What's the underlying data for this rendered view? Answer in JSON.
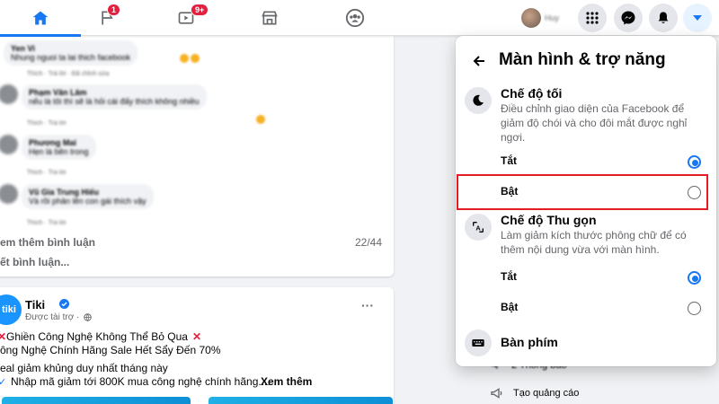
{
  "nav": {
    "flag_badge": "1",
    "watch_badge": "9+",
    "profile_name": "Huy"
  },
  "feed": {
    "comments": [
      {
        "name": "Yen Vi",
        "text": "Nhung nguoi ta lai thich facebook",
        "actions": "Thích · Trả lời · Đã chỉnh sửa"
      },
      {
        "name": "Phạm Văn Lâm",
        "text": "nếu là tôi thì sẽ là hỏi cái đấy thích không nhiều",
        "actions": "Thích · Trả lời"
      },
      {
        "name": "Phương Mai",
        "text": "Hẹn là bên trong",
        "actions": "Thích · Trả lời"
      },
      {
        "name": "Vũ Gia Trung Hiếu",
        "text": "Và rồi phản lên con gái thích vậy",
        "actions": "Thích · Trả lời"
      }
    ],
    "view_more": "em thêm bình luận",
    "comment_count": "22/44",
    "write_comment": "ết bình luận...",
    "post": {
      "page_name": "Tiki",
      "logo_text": "tiki",
      "sponsored": "Được tài trợ ·",
      "line1": "Ghiền Công Nghệ Không Thể Bỏ Qua",
      "line2": "ông Nghệ Chính Hãng Sale Hết Sẩy Đến 70%",
      "line3": "eal giảm khủng duy nhất tháng này",
      "line4": "Nhập mã giảm tới 800K mua công nghệ chính hãng....",
      "see_more": "Xem thêm",
      "options": "···"
    }
  },
  "right_column": {
    "notifications": "2 Thông báo",
    "create_ad": "Tạo quảng cáo"
  },
  "panel": {
    "title": "Màn hình & trợ năng",
    "dark_mode": {
      "title": "Chế độ tối",
      "description": "Điều chỉnh giao diện của Facebook để giảm độ chói và cho đôi mắt được nghỉ ngơi.",
      "off_label": "Tắt",
      "on_label": "Bật",
      "selected": "off"
    },
    "compact_mode": {
      "title": "Chế độ Thu gọn",
      "description": "Làm giảm kích thước phông chữ để có thêm nội dung vừa với màn hình.",
      "off_label": "Tắt",
      "on_label": "Bật",
      "selected": "off"
    },
    "keyboard": "Bàn phím"
  },
  "colors": {
    "accent": "#1877f2",
    "highlight": "#e31b23",
    "badge": "#e41e3f"
  }
}
